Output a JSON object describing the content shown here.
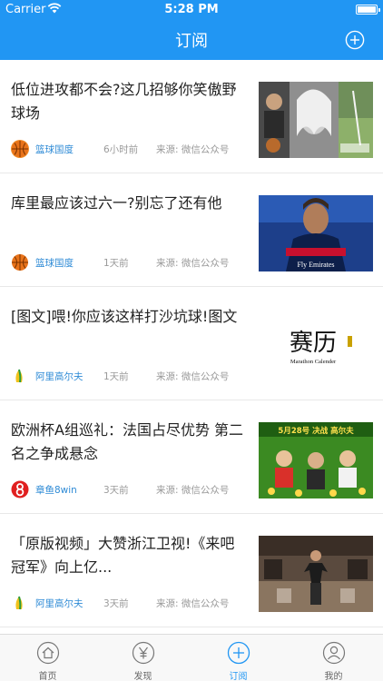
{
  "status_bar": {
    "carrier": "Carrier",
    "time": "5:28 PM"
  },
  "nav": {
    "title": "订阅",
    "add_icon": "plus-circle-icon"
  },
  "colors": {
    "primary": "#2196f3",
    "source_link": "#2f8bd6",
    "meta_text": "#9a9a9a"
  },
  "feed": {
    "items": [
      {
        "title": "低位进攻都不会?这几招够你笑傲野球场",
        "source": "篮球国度",
        "time": "6小时前",
        "origin": "来源: 微信公众号",
        "avatar_icon": "basketball-icon",
        "thumb_text": ""
      },
      {
        "title": "库里最应该过六一?别忘了还有他",
        "source": "篮球国度",
        "time": "1天前",
        "origin": "来源: 微信公众号",
        "avatar_icon": "basketball-icon",
        "thumb_text": "Fly Emirates"
      },
      {
        "title": "[图文]喂!你应该这样打沙坑球!图文",
        "source": "阿里高尔夫",
        "time": "1天前",
        "origin": "来源: 微信公众号",
        "avatar_icon": "golf-logo-icon",
        "thumb_text": "赛历",
        "thumb_sub": "Marathon Calender"
      },
      {
        "title": "欧洲杯A组巡礼：法国占尽优势 第二名之争成悬念",
        "source": "章鱼8win",
        "time": "3天前",
        "origin": "来源: 微信公众号",
        "avatar_icon": "octopus-8-icon",
        "thumb_text": "5月28号 决战 高尔夫"
      },
      {
        "title": "「原版视频」大赞浙江卫视!《来吧冠军》向上亿...",
        "source": "阿里高尔夫",
        "time": "3天前",
        "origin": "来源: 微信公众号",
        "avatar_icon": "golf-logo-icon",
        "thumb_text": ""
      }
    ]
  },
  "tabs": [
    {
      "label": "首页",
      "icon": "home-icon",
      "active": false
    },
    {
      "label": "发现",
      "icon": "yen-icon",
      "active": false
    },
    {
      "label": "订阅",
      "icon": "plus-circle-icon",
      "active": true
    },
    {
      "label": "我的",
      "icon": "user-icon",
      "active": false
    }
  ]
}
